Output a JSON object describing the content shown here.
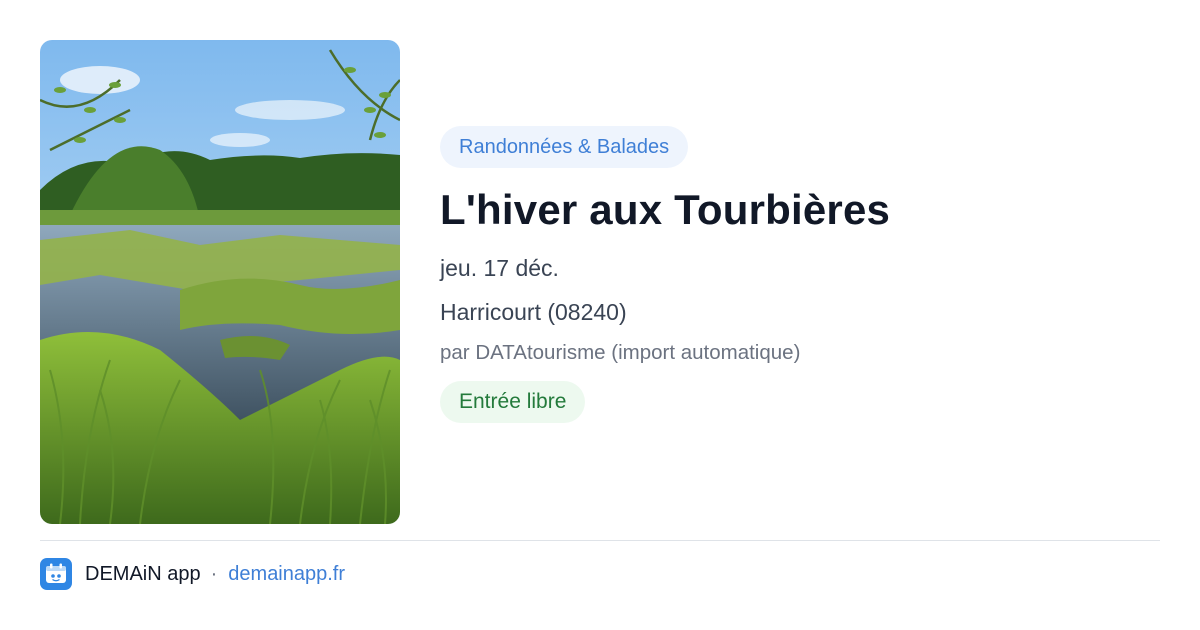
{
  "event": {
    "category": "Randonnées & Balades",
    "title": "L'hiver aux Tourbières",
    "date": "jeu. 17 déc.",
    "location": "Harricourt (08240)",
    "organizer": "par DATAtourisme (import automatique)",
    "price": "Entrée libre",
    "image": "wetland-photo"
  },
  "footer": {
    "app_name": "DEMAiN app",
    "separator": "·",
    "url": "demainapp.fr",
    "logo_icon": "demain-app-logo-icon"
  },
  "colors": {
    "category_text": "#3f7fd6",
    "category_bg": "#eef4fd",
    "price_text": "#237a3b",
    "price_bg": "#edf9ef",
    "link": "#3f7fd6",
    "logo_bg": "#2f86e4"
  }
}
